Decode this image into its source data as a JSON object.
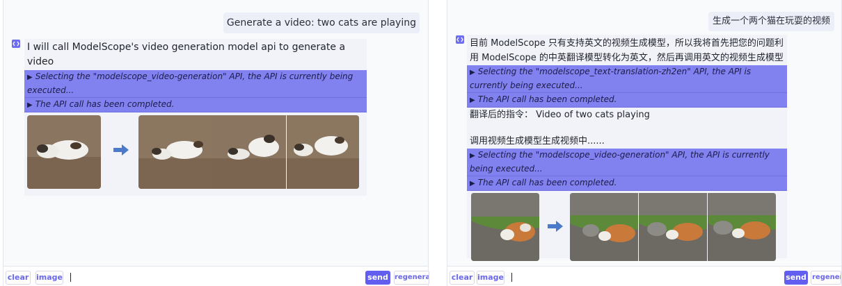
{
  "left": {
    "user_message": "Generate a video: two cats are playing",
    "bot_text": "I will call ModelScope's video generation model api to generate a video",
    "api_rows": [
      "Selecting the \"modelscope_video-generation\" API, the API is currently being executed...",
      "The API call has been completed."
    ]
  },
  "right": {
    "user_message": "生成一个两个猫在玩耍的视频",
    "bot_text": "目前 ModelScope 只有支持英文的视频生成模型，所以我将首先把您的问题利用 ModelScope 的中英翻译模型转化为英文，然后再调用英文的视频生成模型",
    "api_rows_1": [
      "Selecting the \"modelscope_text-translation-zh2en\" API, the API is currently being executed...",
      "The API call has been completed."
    ],
    "translated_line": "翻译后的指令：  Video of two cats playing",
    "calling_line": "调用视频生成模型生成视频中......",
    "api_rows_2": [
      "Selecting the \"modelscope_video-generation\" API, the API is currently being executed...",
      "The API call has been completed."
    ]
  },
  "controls": {
    "clear": "clear",
    "image": "image",
    "send": "send",
    "regenerate": "regenerate"
  },
  "icons": {
    "bot": "bot-avatar-icon",
    "arrow": "right-arrow-icon",
    "expand": "triangle-right-icon"
  },
  "colors": {
    "accent": "#625ef0",
    "api_bar": "#8181f0",
    "arrow": "#4a7ac9"
  }
}
